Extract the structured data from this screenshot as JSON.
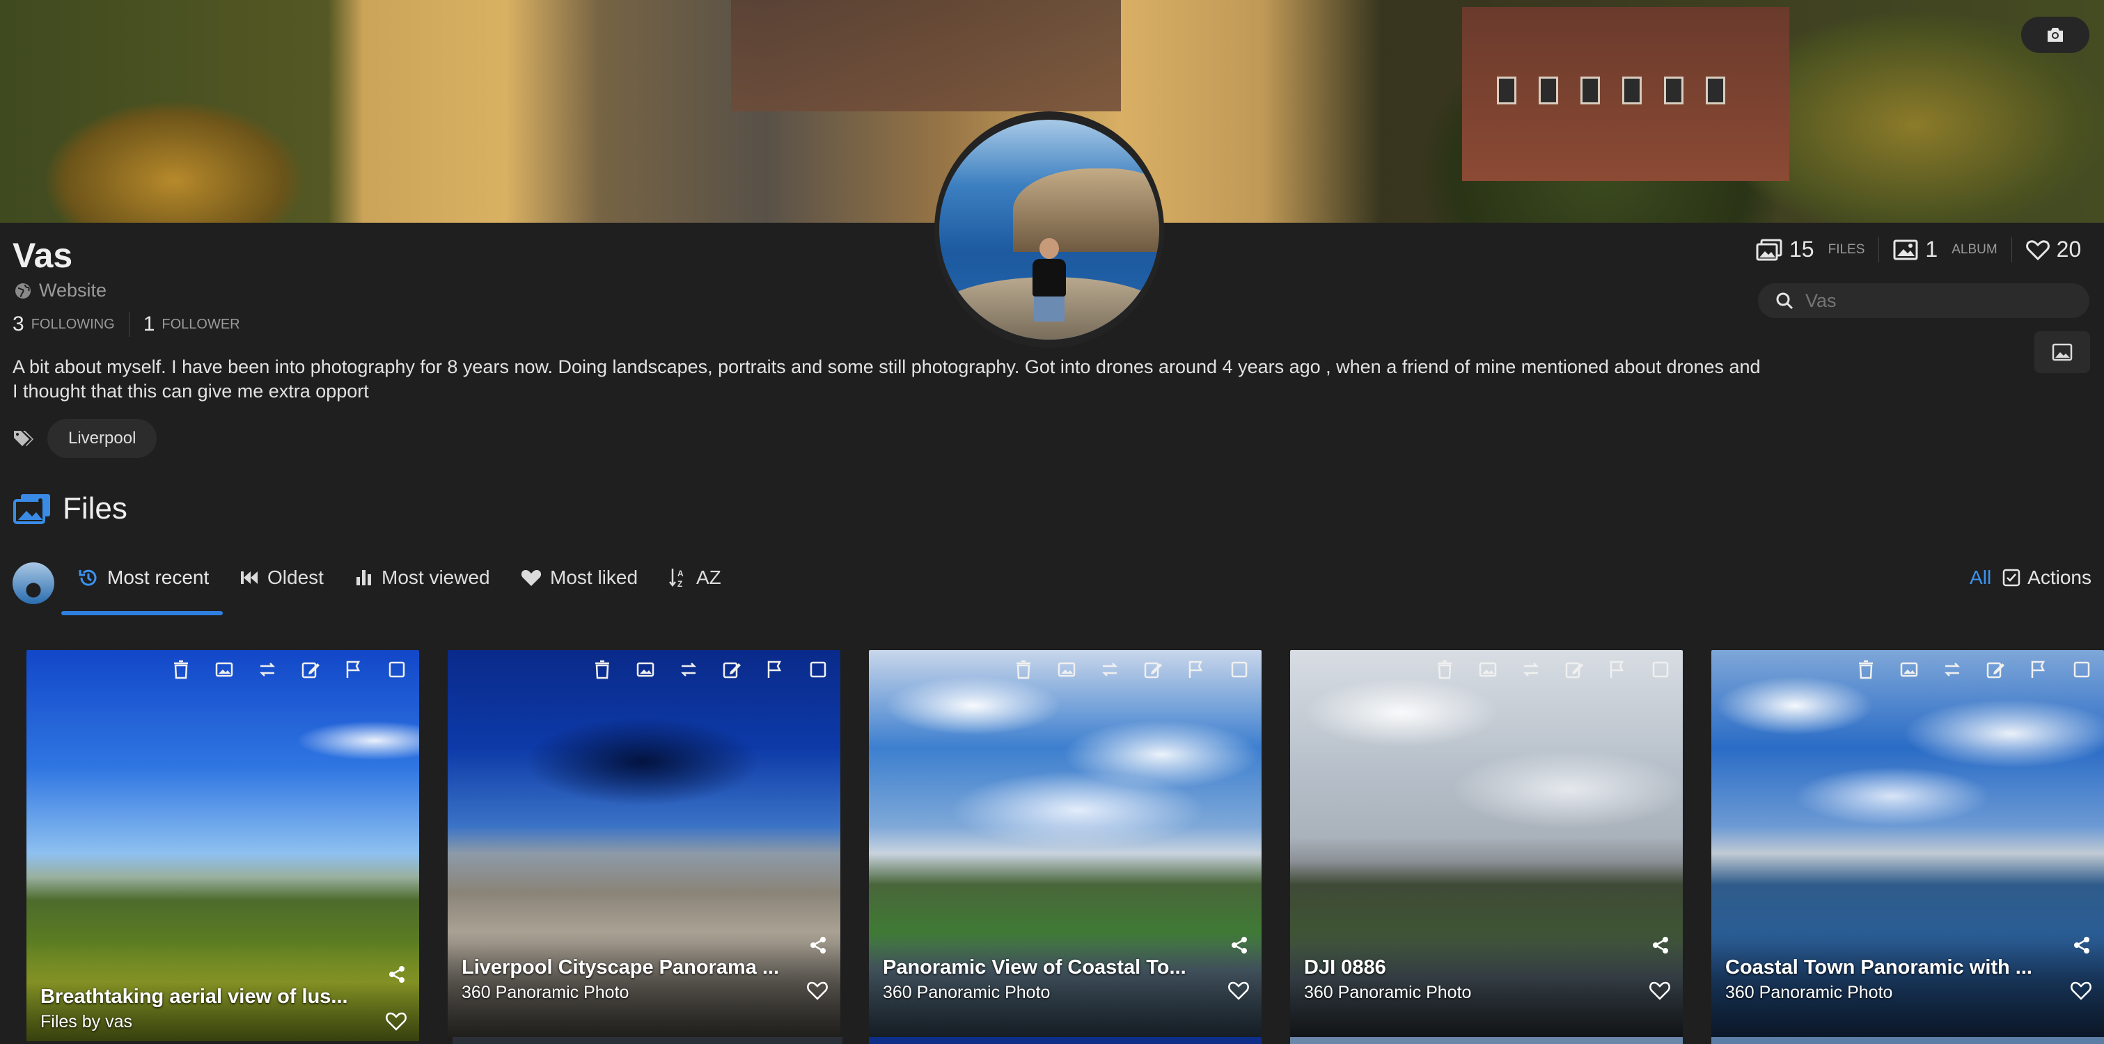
{
  "banner": {
    "camera_icon": "camera-icon"
  },
  "profile": {
    "name": "Vas",
    "website_label": "Website",
    "following_count": "3",
    "following_label": "FOLLOWING",
    "follower_count": "1",
    "follower_label": "FOLLOWER",
    "bio": "A bit about myself. I have been into photography for 8 years now. Doing landscapes, portraits and some still photography. Got into drones around 4 years ago , when a friend of mine mentioned about drones and I thought that this can give me extra opport",
    "tags": [
      "Liverpool"
    ]
  },
  "stats": {
    "files_count": "15",
    "files_label": "FILES",
    "album_count": "1",
    "album_label": "ALBUM",
    "likes_count": "20"
  },
  "search": {
    "placeholder": "Vas"
  },
  "files_section": {
    "title": "Files"
  },
  "tabs": {
    "items": [
      {
        "label": "Most recent",
        "icon": "history-icon"
      },
      {
        "label": "Oldest",
        "icon": "backward-icon"
      },
      {
        "label": "Most viewed",
        "icon": "bar-chart-icon"
      },
      {
        "label": "Most liked",
        "icon": "heart-icon"
      },
      {
        "label": "AZ",
        "icon": "sort-az-icon"
      }
    ],
    "all_label": "All",
    "actions_label": "Actions"
  },
  "cards": [
    {
      "title": "Breathtaking aerial view of lus...",
      "subtitle": "Files by vas"
    },
    {
      "title": "Liverpool Cityscape Panorama ...",
      "subtitle": "360 Panoramic Photo"
    },
    {
      "title": "Panoramic View of Coastal To...",
      "subtitle": "360 Panoramic Photo"
    },
    {
      "title": "DJI 0886",
      "subtitle": "360 Panoramic Photo"
    },
    {
      "title": "Coastal Town Panoramic with ...",
      "subtitle": "360 Panoramic Photo"
    }
  ],
  "colors": {
    "accent": "#2f7fe0",
    "link": "#3b93f0",
    "background": "#1f1f1f"
  }
}
